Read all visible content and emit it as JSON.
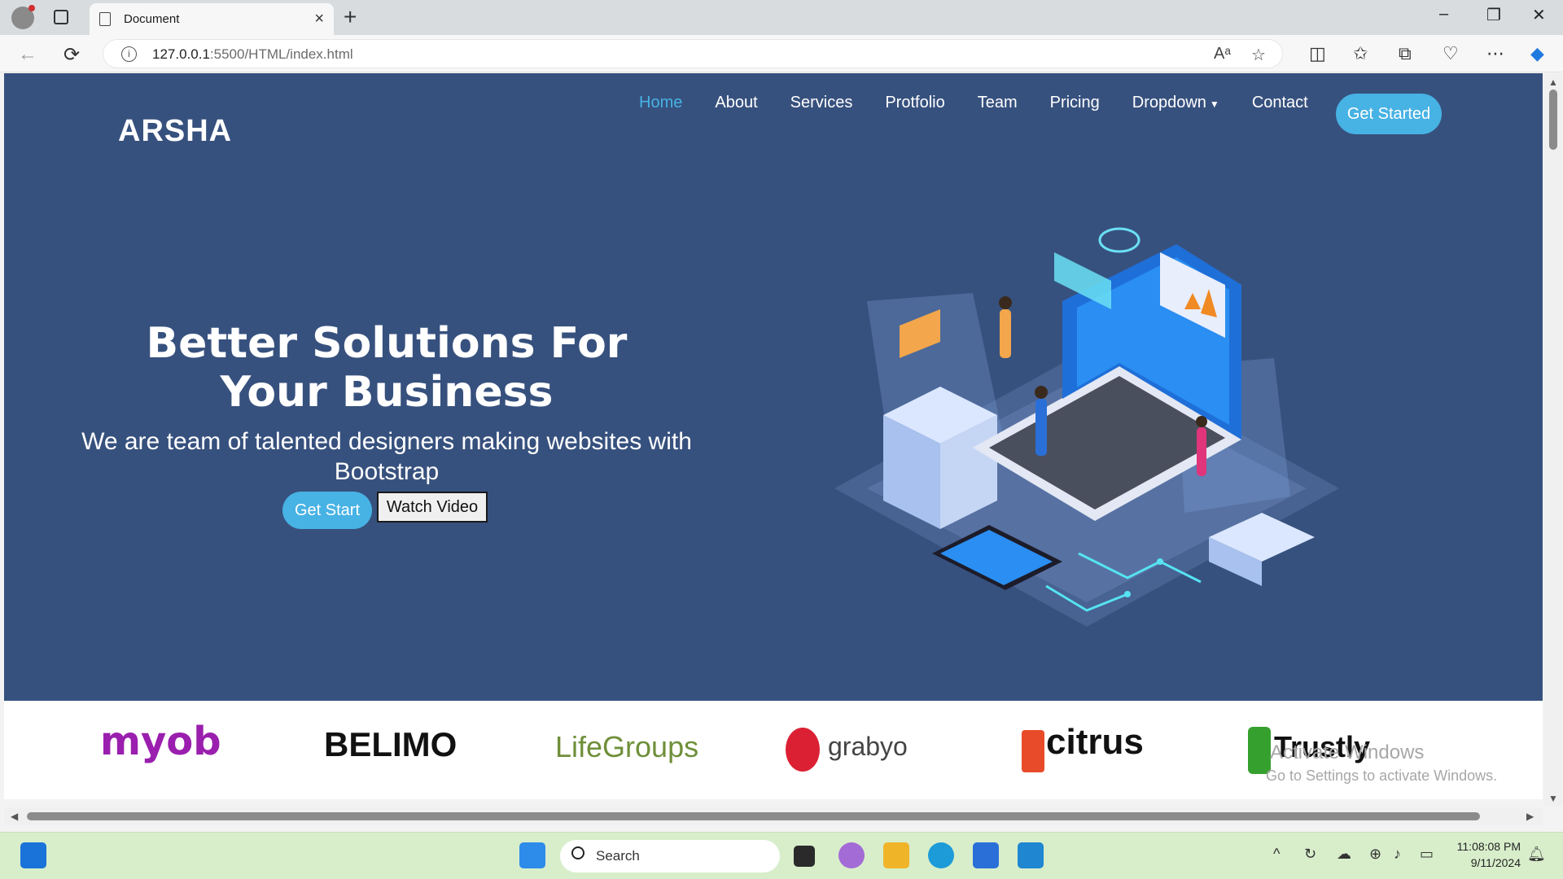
{
  "browser": {
    "tab_title": "Document",
    "url_host": "127.0.0.1",
    "url_path": ":5500/HTML/index.html"
  },
  "site": {
    "brand": "ARSHA",
    "nav": [
      "Home",
      "About",
      "Services",
      "Protfolio",
      "Team",
      "Pricing",
      "Dropdown",
      "Contact"
    ],
    "nav_active": "Home",
    "cta": "Get Started",
    "hero_title": "Better Solutions For Your Business",
    "hero_subtitle": "We are team of talented designers making websites with Bootstrap",
    "btn_primary": "Get Start",
    "btn_secondary": "Watch Video",
    "client_logos": [
      "myob",
      "BELIMO",
      "LifeGroups",
      "grabyo",
      "citrus",
      "Trustly"
    ],
    "colors": {
      "hero_bg": "#37517e",
      "accent": "#47b2e4"
    }
  },
  "watermark": {
    "line1": "Activate Windows",
    "line2": "Go to Settings to activate Windows."
  },
  "taskbar": {
    "search_placeholder": "Search",
    "time": "11:08:08 PM",
    "date": "9/11/2024"
  }
}
